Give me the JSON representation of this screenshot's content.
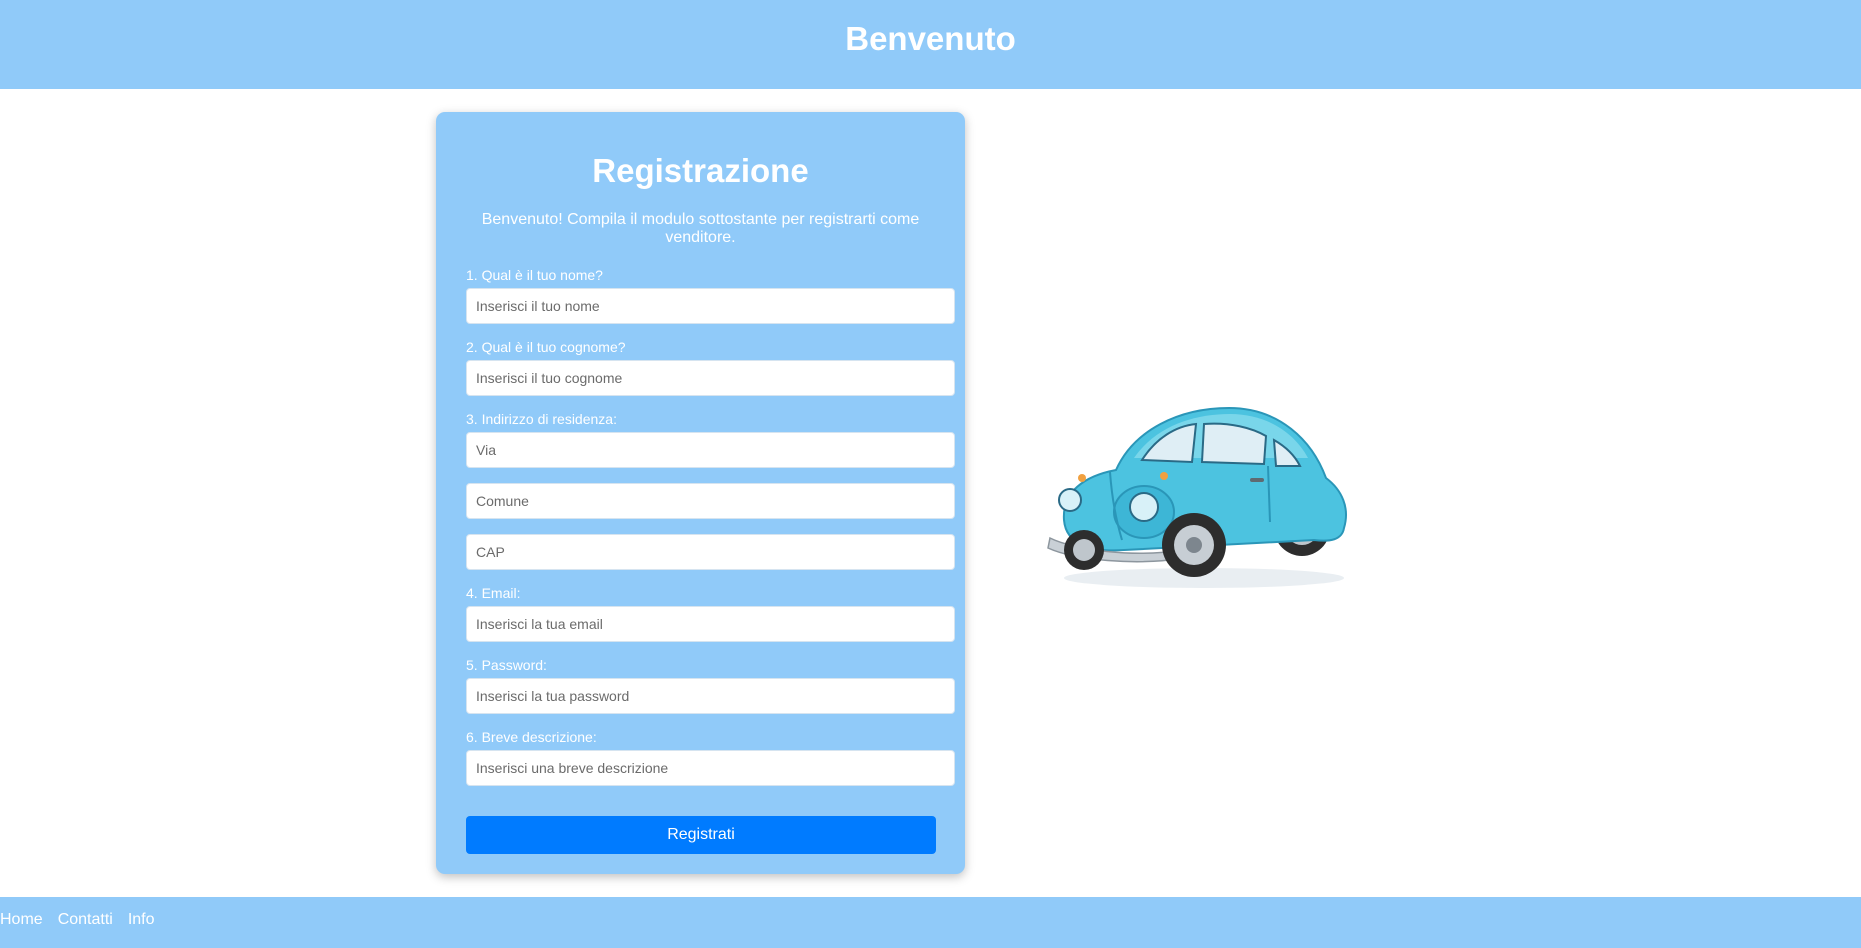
{
  "header": {
    "title": "Benvenuto"
  },
  "form": {
    "title": "Registrazione",
    "intro": "Benvenuto! Compila il modulo sottostante per registrarti come venditore.",
    "fields": {
      "nome": {
        "label": "1. Qual è il tuo nome?",
        "placeholder": "Inserisci il tuo nome"
      },
      "cognome": {
        "label": "2. Qual è il tuo cognome?",
        "placeholder": "Inserisci il tuo cognome"
      },
      "indirizzo": {
        "label": "3. Indirizzo di residenza:",
        "via_placeholder": "Via",
        "comune_placeholder": "Comune",
        "cap_placeholder": "CAP"
      },
      "email": {
        "label": "4. Email:",
        "placeholder": "Inserisci la tua email"
      },
      "password": {
        "label": "5. Password:",
        "placeholder": "Inserisci la tua password"
      },
      "descrizione": {
        "label": "6. Breve descrizione:",
        "placeholder": "Inserisci una breve descrizione"
      }
    },
    "submit_label": "Registrati"
  },
  "image": {
    "icon": "car-illustration"
  },
  "footer": {
    "links": [
      "Home",
      "Contatti",
      "Info"
    ]
  },
  "colors": {
    "header_bg": "#90caf9",
    "card_bg": "#90caf9",
    "button_bg": "#007bff",
    "footer_bg": "#90caf9"
  }
}
